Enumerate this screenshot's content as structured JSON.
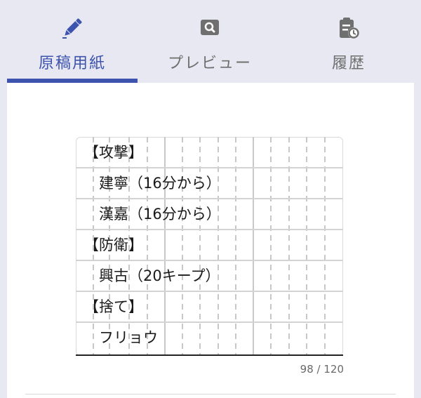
{
  "tabs": [
    {
      "label": "原稿用紙",
      "icon": "pencil-icon",
      "active": true
    },
    {
      "label": "プレビュー",
      "icon": "search-icon",
      "active": false
    },
    {
      "label": "履歴",
      "icon": "clipboard-clock-icon",
      "active": false
    }
  ],
  "manuscript": {
    "lines": [
      "【攻撃】",
      "　建寧（16分から）",
      "　漢嘉（16分から）",
      "【防衛】",
      "　興古（20キープ）",
      "【捨て】",
      "　フリョウ"
    ]
  },
  "counter": {
    "current": "98",
    "separator": " / ",
    "max": "120"
  },
  "colors": {
    "accent": "#3d53ad",
    "tabbar_bg": "#e7e8f2"
  }
}
